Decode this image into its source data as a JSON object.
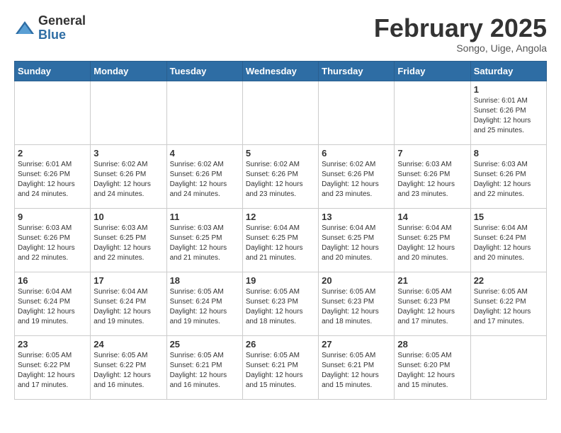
{
  "header": {
    "logo_general": "General",
    "logo_blue": "Blue",
    "month_title": "February 2025",
    "location": "Songo, Uige, Angola"
  },
  "days_of_week": [
    "Sunday",
    "Monday",
    "Tuesday",
    "Wednesday",
    "Thursday",
    "Friday",
    "Saturday"
  ],
  "weeks": [
    [
      {
        "day": "",
        "info": ""
      },
      {
        "day": "",
        "info": ""
      },
      {
        "day": "",
        "info": ""
      },
      {
        "day": "",
        "info": ""
      },
      {
        "day": "",
        "info": ""
      },
      {
        "day": "",
        "info": ""
      },
      {
        "day": "1",
        "info": "Sunrise: 6:01 AM\nSunset: 6:26 PM\nDaylight: 12 hours\nand 25 minutes."
      }
    ],
    [
      {
        "day": "2",
        "info": "Sunrise: 6:01 AM\nSunset: 6:26 PM\nDaylight: 12 hours\nand 24 minutes."
      },
      {
        "day": "3",
        "info": "Sunrise: 6:02 AM\nSunset: 6:26 PM\nDaylight: 12 hours\nand 24 minutes."
      },
      {
        "day": "4",
        "info": "Sunrise: 6:02 AM\nSunset: 6:26 PM\nDaylight: 12 hours\nand 24 minutes."
      },
      {
        "day": "5",
        "info": "Sunrise: 6:02 AM\nSunset: 6:26 PM\nDaylight: 12 hours\nand 23 minutes."
      },
      {
        "day": "6",
        "info": "Sunrise: 6:02 AM\nSunset: 6:26 PM\nDaylight: 12 hours\nand 23 minutes."
      },
      {
        "day": "7",
        "info": "Sunrise: 6:03 AM\nSunset: 6:26 PM\nDaylight: 12 hours\nand 23 minutes."
      },
      {
        "day": "8",
        "info": "Sunrise: 6:03 AM\nSunset: 6:26 PM\nDaylight: 12 hours\nand 22 minutes."
      }
    ],
    [
      {
        "day": "9",
        "info": "Sunrise: 6:03 AM\nSunset: 6:26 PM\nDaylight: 12 hours\nand 22 minutes."
      },
      {
        "day": "10",
        "info": "Sunrise: 6:03 AM\nSunset: 6:25 PM\nDaylight: 12 hours\nand 22 minutes."
      },
      {
        "day": "11",
        "info": "Sunrise: 6:03 AM\nSunset: 6:25 PM\nDaylight: 12 hours\nand 21 minutes."
      },
      {
        "day": "12",
        "info": "Sunrise: 6:04 AM\nSunset: 6:25 PM\nDaylight: 12 hours\nand 21 minutes."
      },
      {
        "day": "13",
        "info": "Sunrise: 6:04 AM\nSunset: 6:25 PM\nDaylight: 12 hours\nand 20 minutes."
      },
      {
        "day": "14",
        "info": "Sunrise: 6:04 AM\nSunset: 6:25 PM\nDaylight: 12 hours\nand 20 minutes."
      },
      {
        "day": "15",
        "info": "Sunrise: 6:04 AM\nSunset: 6:24 PM\nDaylight: 12 hours\nand 20 minutes."
      }
    ],
    [
      {
        "day": "16",
        "info": "Sunrise: 6:04 AM\nSunset: 6:24 PM\nDaylight: 12 hours\nand 19 minutes."
      },
      {
        "day": "17",
        "info": "Sunrise: 6:04 AM\nSunset: 6:24 PM\nDaylight: 12 hours\nand 19 minutes."
      },
      {
        "day": "18",
        "info": "Sunrise: 6:05 AM\nSunset: 6:24 PM\nDaylight: 12 hours\nand 19 minutes."
      },
      {
        "day": "19",
        "info": "Sunrise: 6:05 AM\nSunset: 6:23 PM\nDaylight: 12 hours\nand 18 minutes."
      },
      {
        "day": "20",
        "info": "Sunrise: 6:05 AM\nSunset: 6:23 PM\nDaylight: 12 hours\nand 18 minutes."
      },
      {
        "day": "21",
        "info": "Sunrise: 6:05 AM\nSunset: 6:23 PM\nDaylight: 12 hours\nand 17 minutes."
      },
      {
        "day": "22",
        "info": "Sunrise: 6:05 AM\nSunset: 6:22 PM\nDaylight: 12 hours\nand 17 minutes."
      }
    ],
    [
      {
        "day": "23",
        "info": "Sunrise: 6:05 AM\nSunset: 6:22 PM\nDaylight: 12 hours\nand 17 minutes."
      },
      {
        "day": "24",
        "info": "Sunrise: 6:05 AM\nSunset: 6:22 PM\nDaylight: 12 hours\nand 16 minutes."
      },
      {
        "day": "25",
        "info": "Sunrise: 6:05 AM\nSunset: 6:21 PM\nDaylight: 12 hours\nand 16 minutes."
      },
      {
        "day": "26",
        "info": "Sunrise: 6:05 AM\nSunset: 6:21 PM\nDaylight: 12 hours\nand 15 minutes."
      },
      {
        "day": "27",
        "info": "Sunrise: 6:05 AM\nSunset: 6:21 PM\nDaylight: 12 hours\nand 15 minutes."
      },
      {
        "day": "28",
        "info": "Sunrise: 6:05 AM\nSunset: 6:20 PM\nDaylight: 12 hours\nand 15 minutes."
      },
      {
        "day": "",
        "info": ""
      }
    ]
  ]
}
